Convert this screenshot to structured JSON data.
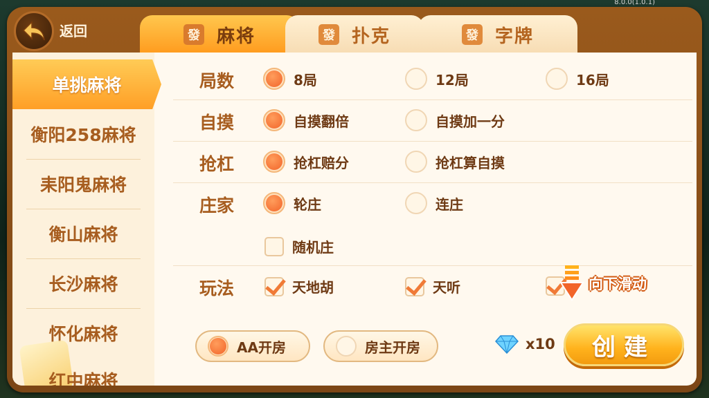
{
  "version": "8.0.0(1.0.1)",
  "header": {
    "back_label": "返回",
    "tabs": [
      {
        "tile": "發",
        "label": "麻将",
        "active": true
      },
      {
        "tile": "發",
        "label": "扑克",
        "active": false
      },
      {
        "tile": "發",
        "label": "字牌",
        "active": false
      }
    ]
  },
  "sidebar": {
    "items": [
      {
        "label": "单挑麻将",
        "active": true
      },
      {
        "label": "衡阳258麻将"
      },
      {
        "label": "耒阳鬼麻将"
      },
      {
        "label": "衡山麻将"
      },
      {
        "label": "长沙麻将"
      },
      {
        "label": "怀化麻将"
      },
      {
        "label": "红中麻将"
      }
    ]
  },
  "rules": {
    "rounds": {
      "label": "局数",
      "options": [
        {
          "label": "8局",
          "selected": true
        },
        {
          "label": "12局",
          "selected": false
        },
        {
          "label": "16局",
          "selected": false
        }
      ]
    },
    "self_draw": {
      "label": "自摸",
      "options": [
        {
          "label": "自摸翻倍",
          "selected": true
        },
        {
          "label": "自摸加一分",
          "selected": false
        }
      ]
    },
    "rob_kong": {
      "label": "抢杠",
      "options": [
        {
          "label": "抢杠赔分",
          "selected": true
        },
        {
          "label": "抢杠算自摸",
          "selected": false
        }
      ]
    },
    "dealer": {
      "label": "庄家",
      "options": [
        {
          "label": "轮庄",
          "selected": true
        },
        {
          "label": "连庄",
          "selected": false
        }
      ],
      "random": {
        "label": "随机庄",
        "checked": false
      }
    },
    "play": {
      "label": "玩法",
      "options": [
        {
          "label": "天地胡",
          "checked": true
        },
        {
          "label": "天听",
          "checked": true
        },
        {
          "label": "",
          "checked": true
        }
      ]
    }
  },
  "scroll_hint": "向下滑动",
  "payment": {
    "aa": {
      "label": "AA开房",
      "selected": true
    },
    "owner": {
      "label": "房主开房",
      "selected": false
    }
  },
  "cost": {
    "icon": "diamond-icon",
    "amount": "x10"
  },
  "create_label": "创建"
}
